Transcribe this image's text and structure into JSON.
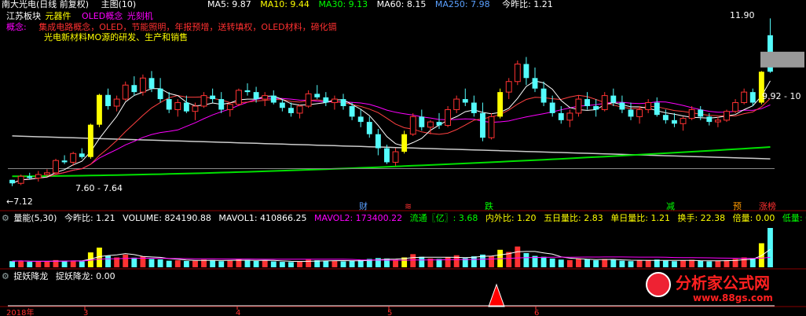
{
  "colors": {
    "up": "#ff3232",
    "down": "#54fcfc",
    "limit": "#ffff00",
    "ma5": "#ffffff",
    "ma10": "#ffff00",
    "ma30": "#ff00ff",
    "ma60": "#00ff00",
    "ma250": "#aaaaaa"
  },
  "header": {
    "stock": "南大光电(日线 前复权)",
    "indicator": "主图(10)",
    "ma5": "MA5: 9.87",
    "ma10": "MA10: 9.44",
    "ma30": "MA30: 9.13",
    "ma60": "MA60: 8.15",
    "ma250": "MA250: 7.98",
    "ratio": "今昨比: 1.21"
  },
  "info": {
    "sector_label": "江苏板块",
    "sector_value": "元器件",
    "concept1": "OLED概念",
    "concept2": "光刻机",
    "concept_label": "概念:",
    "concept_text": "集成电路概念，OLED，节能照明，年报预增，送转填权，OLED材料，碲化镉",
    "line3": "光电新材料MO源的研发、生产和销售"
  },
  "price_labels": {
    "high": "11.90",
    "current": "9.92 - 10",
    "low": "←7.12",
    "mid": "7.60 - 7.64"
  },
  "events": [
    {
      "text": "财"
    },
    {
      "text": "≋"
    },
    {
      "text": "跌"
    },
    {
      "text": "减"
    },
    {
      "text": "预"
    },
    {
      "text": "涨榜"
    }
  ],
  "volume_header": {
    "title": "量能(5,30)",
    "ratio": "今昨比: 1.21",
    "volume": "VOLUME: 824190.88",
    "mavol1": "MAVOL1: 410866.25",
    "mavol2": "MAVOL2: 173400.22",
    "float": "流通〖亿〗: 3.68",
    "inout": "内外比: 1.20",
    "five": "五日量比: 2.83",
    "single": "单日量比: 1.21",
    "turnover": "换手: 22.38",
    "multiple": "倍量: 0.00",
    "low": "低量: 0"
  },
  "indicator_header": {
    "title": "捉妖降龙",
    "value": "捉妖降龙: 0.00"
  },
  "axis": {
    "year": "2018年",
    "months": [
      "3",
      "4",
      "5",
      "6"
    ]
  },
  "watermark": {
    "brand": "分析家公式网",
    "url": "www.88gs.com"
  },
  "chart_data": {
    "type": "candlestick",
    "candles": [
      [
        7.3,
        7.3,
        7.12,
        7.2
      ],
      [
        7.2,
        7.45,
        7.15,
        7.4
      ],
      [
        7.4,
        7.5,
        7.3,
        7.35
      ],
      [
        7.35,
        7.55,
        7.25,
        7.45
      ],
      [
        7.45,
        7.6,
        7.4,
        7.5
      ],
      [
        7.5,
        7.9,
        7.45,
        7.85
      ],
      [
        7.85,
        8.0,
        7.75,
        7.8
      ],
      [
        7.8,
        8.1,
        7.7,
        8.05
      ],
      [
        8.05,
        8.2,
        7.9,
        7.95
      ],
      [
        7.95,
        8.9,
        7.9,
        8.87
      ],
      [
        8.87,
        9.75,
        8.8,
        9.72
      ],
      [
        9.72,
        9.9,
        9.3,
        9.4
      ],
      [
        9.4,
        9.7,
        9.25,
        9.6
      ],
      [
        9.6,
        10.1,
        9.55,
        10.0
      ],
      [
        10.0,
        10.25,
        9.7,
        9.8
      ],
      [
        9.8,
        10.3,
        9.7,
        10.2
      ],
      [
        10.2,
        10.4,
        9.8,
        9.9
      ],
      [
        9.9,
        10.2,
        9.5,
        9.6
      ],
      [
        9.6,
        9.8,
        9.2,
        9.3
      ],
      [
        9.3,
        9.6,
        9.1,
        9.5
      ],
      [
        9.5,
        9.7,
        9.2,
        9.25
      ],
      [
        9.25,
        9.5,
        9.0,
        9.4
      ],
      [
        9.4,
        9.8,
        9.35,
        9.7
      ],
      [
        9.7,
        9.9,
        9.5,
        9.6
      ],
      [
        9.6,
        9.8,
        9.2,
        9.3
      ],
      [
        9.3,
        9.5,
        9.1,
        9.45
      ],
      [
        9.45,
        9.9,
        9.4,
        9.85
      ],
      [
        9.85,
        10.05,
        9.7,
        9.8
      ],
      [
        9.8,
        9.95,
        9.5,
        9.6
      ],
      [
        9.6,
        9.8,
        9.4,
        9.7
      ],
      [
        9.7,
        9.85,
        9.45,
        9.5
      ],
      [
        9.5,
        9.6,
        9.25,
        9.35
      ],
      [
        9.35,
        9.5,
        9.1,
        9.2
      ],
      [
        9.2,
        9.45,
        9.05,
        9.4
      ],
      [
        9.4,
        9.85,
        9.35,
        9.75
      ],
      [
        9.75,
        10.0,
        9.6,
        9.65
      ],
      [
        9.65,
        9.8,
        9.4,
        9.5
      ],
      [
        9.5,
        9.7,
        9.3,
        9.6
      ],
      [
        9.6,
        9.75,
        9.3,
        9.4
      ],
      [
        9.4,
        9.5,
        9.0,
        9.1
      ],
      [
        9.1,
        9.3,
        8.8,
        8.95
      ],
      [
        8.95,
        9.1,
        8.5,
        8.6
      ],
      [
        8.6,
        8.75,
        8.0,
        8.2
      ],
      [
        8.2,
        8.3,
        7.75,
        7.8
      ],
      [
        7.8,
        8.2,
        7.7,
        8.1
      ],
      [
        8.1,
        8.7,
        8.05,
        8.6
      ],
      [
        8.6,
        9.2,
        8.55,
        9.1
      ],
      [
        9.1,
        9.3,
        8.7,
        8.8
      ],
      [
        8.8,
        9.0,
        8.6,
        8.95
      ],
      [
        8.95,
        9.2,
        8.75,
        8.85
      ],
      [
        8.85,
        9.4,
        8.8,
        9.3
      ],
      [
        9.3,
        9.7,
        9.2,
        9.6
      ],
      [
        9.6,
        9.9,
        9.4,
        9.5
      ],
      [
        9.5,
        9.7,
        9.1,
        9.2
      ],
      [
        9.2,
        9.5,
        8.4,
        8.5
      ],
      [
        8.5,
        9.2,
        8.45,
        9.1
      ],
      [
        9.1,
        9.9,
        9.05,
        9.8
      ],
      [
        9.8,
        10.2,
        9.6,
        10.1
      ],
      [
        10.1,
        10.7,
        10.0,
        10.6
      ],
      [
        10.6,
        10.8,
        10.0,
        10.2
      ],
      [
        10.2,
        10.5,
        9.8,
        9.9
      ],
      [
        9.9,
        10.1,
        9.4,
        9.5
      ],
      [
        9.5,
        9.7,
        9.1,
        9.2
      ],
      [
        9.2,
        9.4,
        8.9,
        9.0
      ],
      [
        9.0,
        9.3,
        8.8,
        9.2
      ],
      [
        9.2,
        9.7,
        9.1,
        9.6
      ],
      [
        9.6,
        9.8,
        9.3,
        9.4
      ],
      [
        9.4,
        9.6,
        9.1,
        9.3
      ],
      [
        9.3,
        9.8,
        9.25,
        9.7
      ],
      [
        9.7,
        9.9,
        9.4,
        9.5
      ],
      [
        9.5,
        9.7,
        9.2,
        9.3
      ],
      [
        9.3,
        9.5,
        9.0,
        9.1
      ],
      [
        9.1,
        9.4,
        8.9,
        9.3
      ],
      [
        9.3,
        9.6,
        9.2,
        9.5
      ],
      [
        9.5,
        9.65,
        9.1,
        9.15
      ],
      [
        9.15,
        9.3,
        8.9,
        9.0
      ],
      [
        9.0,
        9.2,
        8.8,
        8.9
      ],
      [
        8.9,
        9.1,
        8.7,
        9.05
      ],
      [
        9.05,
        9.4,
        9.0,
        9.3
      ],
      [
        9.3,
        9.4,
        9.0,
        9.1
      ],
      [
        9.1,
        9.2,
        8.85,
        8.95
      ],
      [
        8.95,
        9.1,
        8.8,
        9.0
      ],
      [
        9.0,
        9.3,
        8.95,
        9.25
      ],
      [
        9.25,
        9.6,
        9.2,
        9.5
      ],
      [
        9.5,
        9.9,
        9.45,
        9.8
      ],
      [
        9.8,
        9.9,
        9.4,
        9.5
      ],
      [
        9.5,
        10.4,
        9.45,
        10.38
      ],
      [
        10.38,
        11.9,
        10.35,
        11.42
      ]
    ],
    "limit_up_index": [
      9,
      10,
      45,
      56,
      86,
      87
    ],
    "volume": [
      28,
      30,
      25,
      27,
      26,
      33,
      29,
      31,
      27,
      68,
      90,
      52,
      45,
      58,
      44,
      50,
      38,
      36,
      30,
      32,
      29,
      30,
      35,
      33,
      28,
      30,
      36,
      34,
      29,
      31,
      27,
      25,
      24,
      26,
      35,
      32,
      29,
      30,
      27,
      30,
      33,
      38,
      42,
      40,
      35,
      45,
      60,
      48,
      40,
      38,
      45,
      55,
      42,
      50,
      58,
      52,
      80,
      70,
      95,
      65,
      52,
      48,
      40,
      35,
      33,
      40,
      36,
      32,
      38,
      34,
      30,
      28,
      31,
      33,
      35,
      30,
      28,
      31,
      34,
      29,
      27,
      29,
      33,
      38,
      45,
      40,
      110,
      180
    ],
    "volume_ylim": [
      0,
      180
    ],
    "ylim": [
      6.6,
      12.2
    ],
    "markers": {
      "high": 11.9,
      "current": 10.38,
      "low": 7.12,
      "mid": 7.62
    }
  }
}
